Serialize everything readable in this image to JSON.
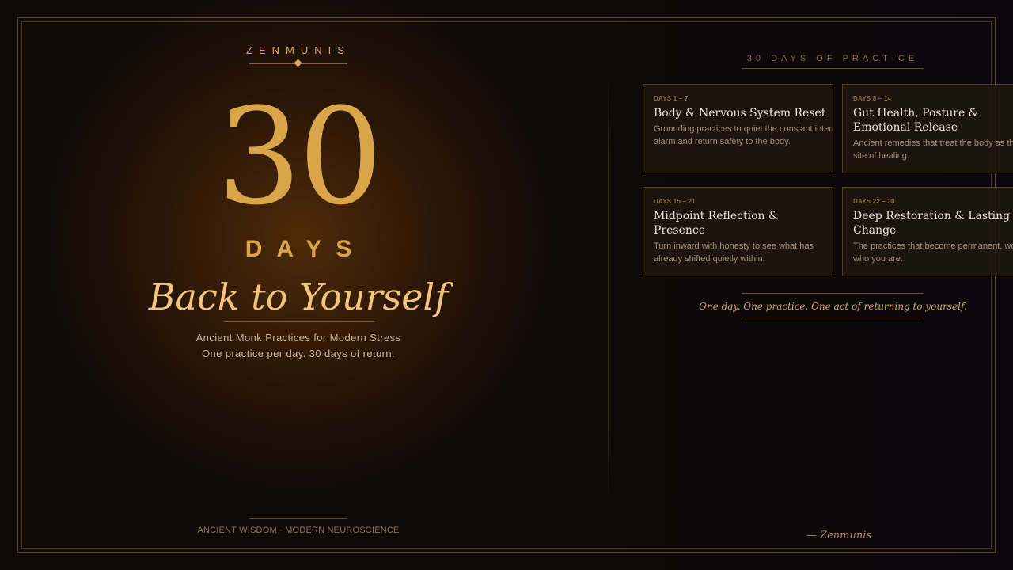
{
  "brand": "ZENMUNIS",
  "hero": {
    "number": "30",
    "unit": "DAYS",
    "headline": "Back to Yourself",
    "subtitle_1": "Ancient Monk Practices for Modern Stress",
    "subtitle_2": "One practice per day. 30 days of return."
  },
  "footer_left": "ANCIENT WISDOM · MODERN NEUROSCIENCE",
  "section_title": "30 DAYS OF PRACTICE",
  "phases": [
    {
      "range": "DAYS 1 – 7",
      "title": "Body & Nervous System Reset",
      "description": "Grounding practices to quiet the constant internal alarm and return safety to the body."
    },
    {
      "range": "DAYS 8 – 14",
      "title": "Gut Health, Posture & Emotional Release",
      "description": "Ancient remedies that treat the body as the original site of healing."
    },
    {
      "range": "DAYS 15 – 21",
      "title": "Midpoint Reflection & Presence",
      "description": "Turn inward with honesty to see what has already shifted quietly within."
    },
    {
      "range": "DAYS 22 – 30",
      "title": "Deep Restoration & Lasting Change",
      "description": "The practices that become permanent, woven into who you are."
    }
  ],
  "mantra": "One day. One practice. One act of returning to yourself.",
  "signature": "— Zenmunis",
  "colors": {
    "accent_gold": "#d8a548",
    "headline_gold": "#f0c67c",
    "background": "#0d0808"
  }
}
